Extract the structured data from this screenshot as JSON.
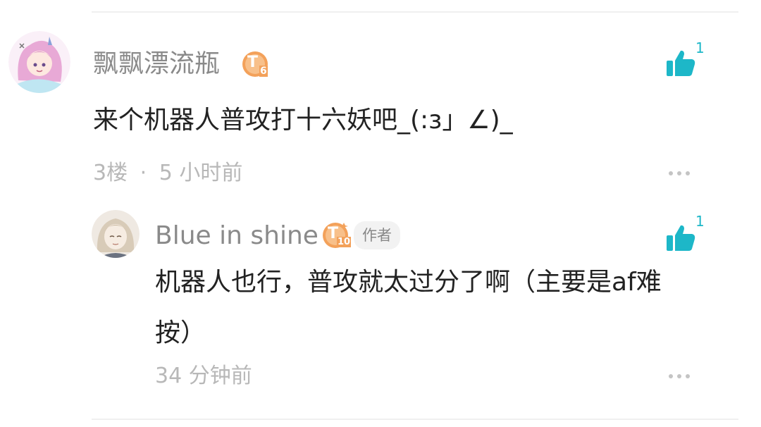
{
  "comment": {
    "username": "飘飘漂流瓶",
    "level_badge": "T",
    "level_number": "6",
    "text": "来个机器人普攻打十六妖吧_(:з」∠)_",
    "floor": "3楼",
    "separator": "·",
    "time": "5 小时前",
    "like_count": "1"
  },
  "reply": {
    "username": "Blue in shine",
    "level_badge": "T",
    "level_number": "10",
    "author_tag": "作者",
    "text_line1": "机器人也行，普攻就太过分了啊（主要是af难",
    "text_line2": "按）",
    "time": "34 分钟前",
    "like_count": "1"
  },
  "colors": {
    "accent": "#1db7c8",
    "badge_orange": "#f3a15a",
    "meta_text": "#b8b8b8",
    "username_text": "#8a8a8a"
  },
  "icons": {
    "like": "thumbs-up-icon",
    "more": "more-dots-icon"
  }
}
